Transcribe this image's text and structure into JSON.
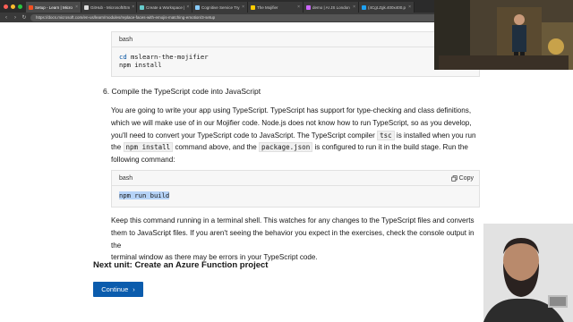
{
  "browser": {
    "tabs": [
      {
        "label": "Setup - Learn | Micro"
      },
      {
        "label": "GitHub - Microsoft/Em"
      },
      {
        "label": "Create a Workspace |"
      },
      {
        "label": "Cognitive Service Try"
      },
      {
        "label": "The Mojifier"
      },
      {
        "label": "demo | AI JS London"
      },
      {
        "label": "(4Cgt.Zgk.400x400.p"
      }
    ],
    "url": "https://docs.microsoft.com/en-us/learn/modules/replace-faces-with-emojis-matching-emotion/3-setup",
    "colors": {
      "chrome": "#2b2b2b",
      "close": "#ff5f57",
      "min": "#febc2e",
      "max": "#28c840"
    }
  },
  "codeblock1": {
    "lang": "bash",
    "lines": [
      {
        "keyword": "cd",
        "rest": " mslearn-the-mojifier"
      },
      {
        "keyword": "",
        "rest": "npm install"
      }
    ]
  },
  "step6": {
    "title": "6. Compile the TypeScript code into JavaScript",
    "para1": [
      "You are going to write your app using TypeScript. TypeScript has support for type-checking and class definitions,",
      "which we will make use of in our Mojifier code. Node.js does not know how to run TypeScript, so as you develop,",
      "you'll need to convert your TypeScript code to JavaScript. The TypeScript compiler",
      "is installed when you run",
      "the",
      "npm install",
      "command above, and the",
      "package.json",
      "is configured to run it in the build stage. Run the",
      "following command:"
    ],
    "tsc": "tsc"
  },
  "codeblock2": {
    "lang": "bash",
    "copy_label": "Copy",
    "line": "npm run build"
  },
  "para2": [
    "Keep this command running in a terminal shell. This watches for any changes to the TypeScript files and converts",
    "them to JavaScript files. If you aren't seeing the behavior you expect in the exercises, check the console output in the",
    "terminal window as there may be errors in your TypeScript code."
  ],
  "next_unit": "Next unit: Create an Azure Function project",
  "continue_label": "Continue",
  "icons": {
    "copy": "copy-icon",
    "chevron": "chevron-right-icon"
  }
}
